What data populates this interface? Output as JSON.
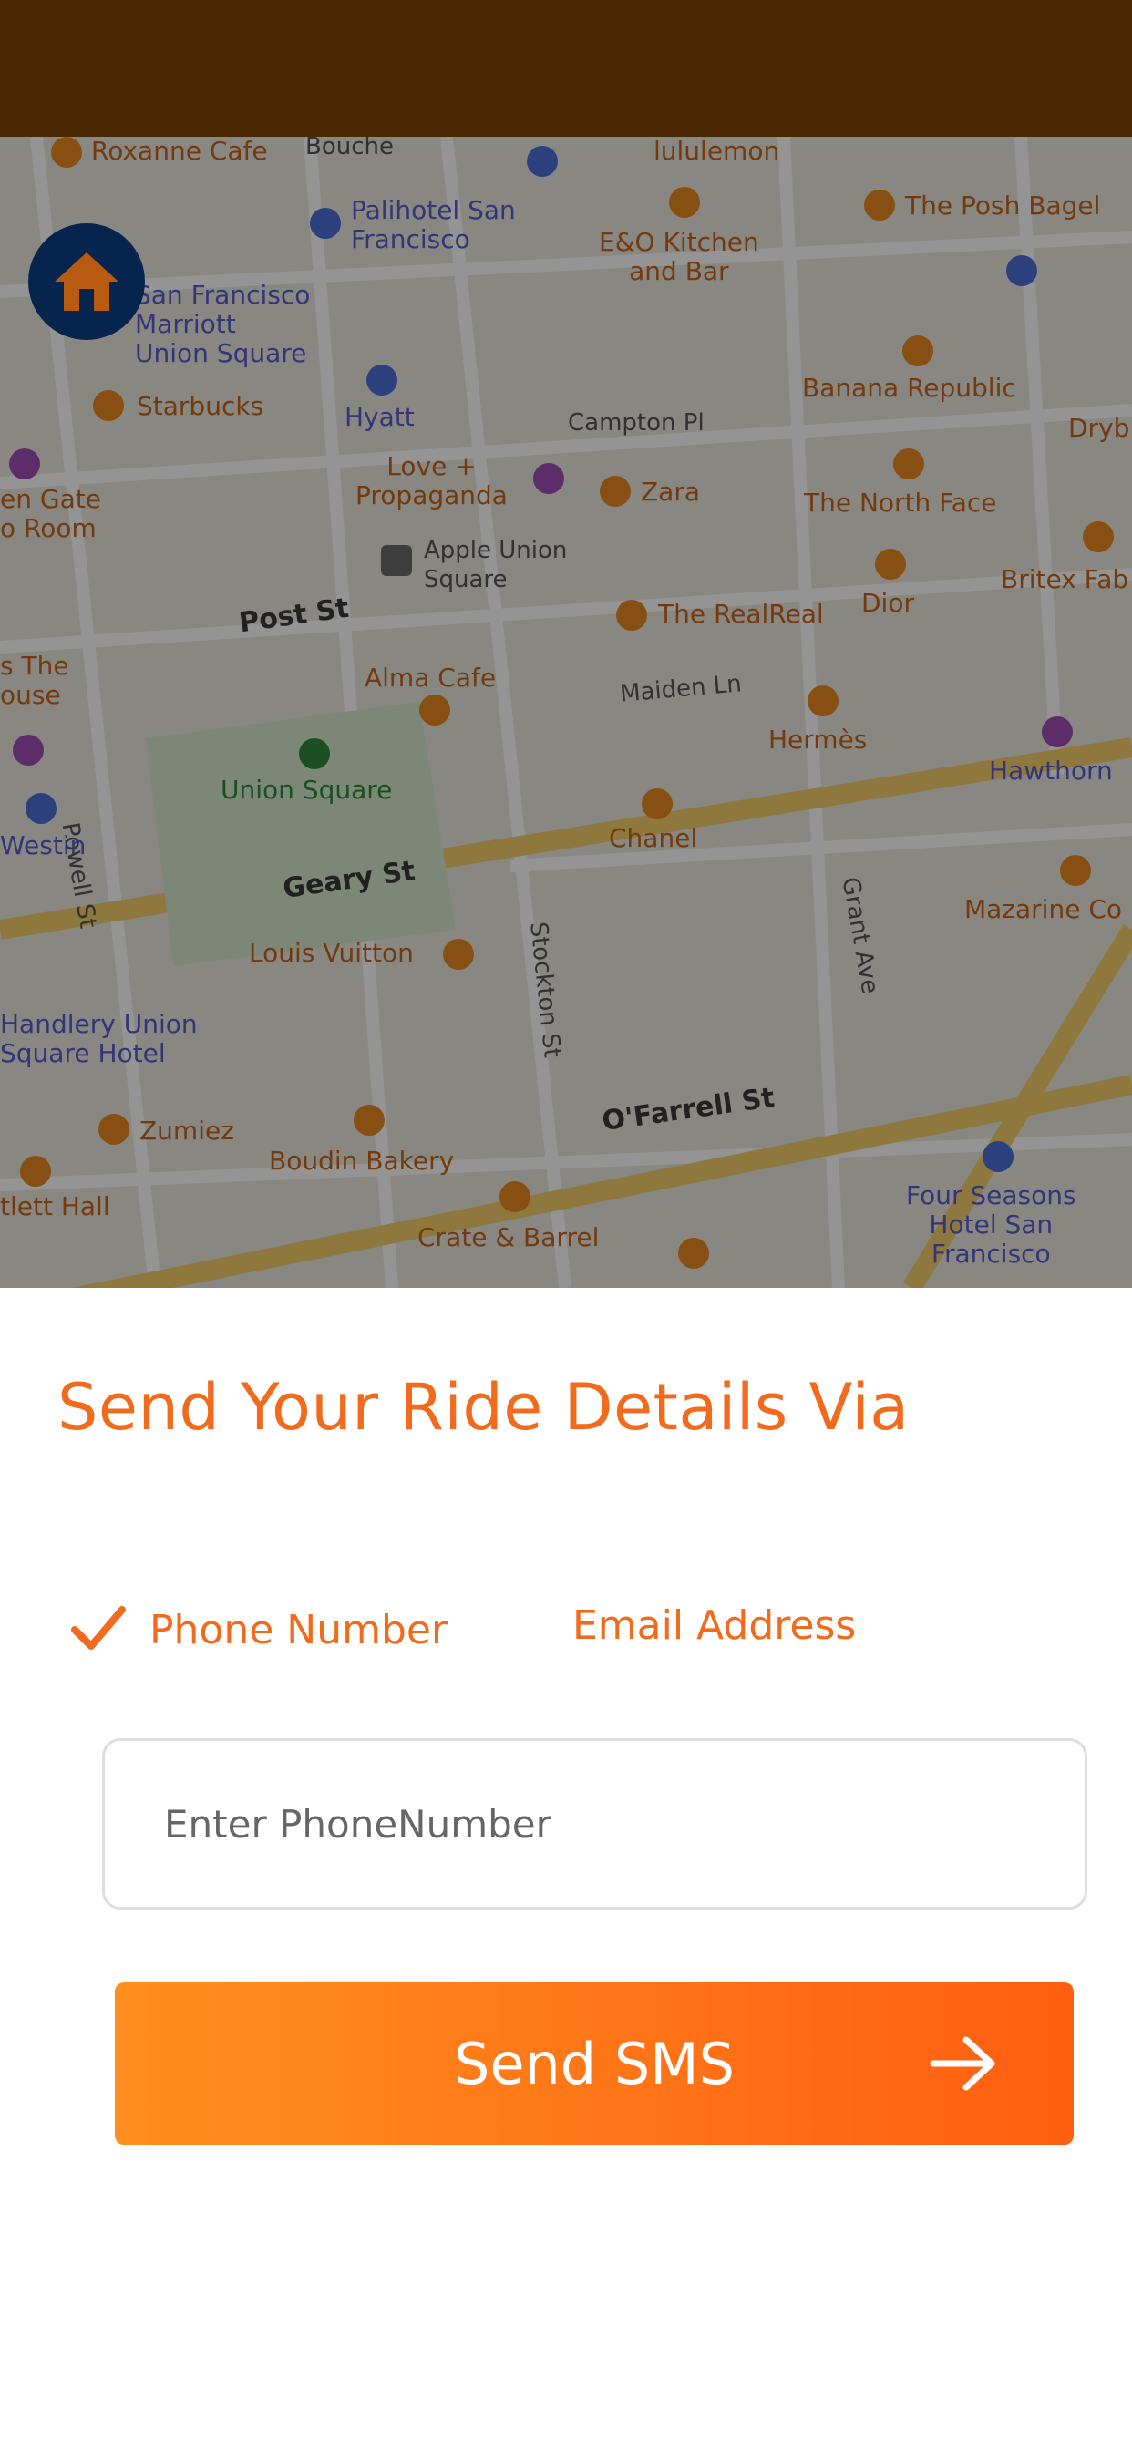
{
  "colors": {
    "status_bar": "#4a2802",
    "accent": "#f26a1b",
    "button_gradient_start": "#ff8f1e",
    "button_gradient_end": "#ff5e12",
    "home_button": "#07244f",
    "home_icon": "#b85a10"
  },
  "map": {
    "streets": {
      "post": "Post St",
      "geary": "Geary St",
      "ofarrell": "O'Farrell St",
      "powell": "Powell St",
      "stockton": "Stockton St",
      "grant": "Grant Ave",
      "maiden": "Maiden Ln",
      "campton": "Campton Pl"
    },
    "places": {
      "roxanne": "Roxanne Cafe",
      "bouche": "Bouche",
      "lululemon": "lululemon",
      "palihotel": "Palihotel San\nFrancisco",
      "eo_kitchen": "E&O Kitchen\nand Bar",
      "posh_bagel": "The Posh Bagel",
      "marriott": "San Francisco\nMarriott\nUnion Square",
      "starbucks": "Starbucks",
      "hyatt": "Hyatt",
      "banana": "Banana Republic",
      "dryb": "Dryb",
      "golden_gate": "en Gate\no Room",
      "love_prop": "Love +\nPropaganda",
      "zara": "Zara",
      "north_face": "The North Face",
      "apple": "Apple Union\nSquare",
      "britex": "Britex Fab",
      "dior": "Dior",
      "realreal": "The RealReal",
      "house": "s The\nouse",
      "alma": "Alma Cafe",
      "hermes": "Hermès",
      "union_square": "Union Square",
      "hawthorn": "Hawthorn",
      "westin": "Westin",
      "chanel": "Chanel",
      "mazarine": "Mazarine Co",
      "louis_vuitton": "Louis Vuitton",
      "handlery": "Handlery Union\nSquare Hotel",
      "zumiez": "Zumiez",
      "boudin": "Boudin Bakery",
      "four_seasons": "Four Seasons\nHotel San\nFrancisco",
      "tlett_hall": "tlett Hall",
      "crate_barrel": "Crate & Barrel"
    }
  },
  "home_button": {
    "icon": "home-icon"
  },
  "sheet": {
    "title": "Send Your Ride Details Via",
    "tabs": {
      "phone": "Phone Number",
      "email": "Email Address"
    },
    "selected_tab": "phone",
    "input": {
      "placeholder": "Enter PhoneNumber",
      "value": ""
    },
    "send_button": "Send SMS",
    "send_icon": "arrow-right-icon",
    "check_icon": "check-icon"
  }
}
